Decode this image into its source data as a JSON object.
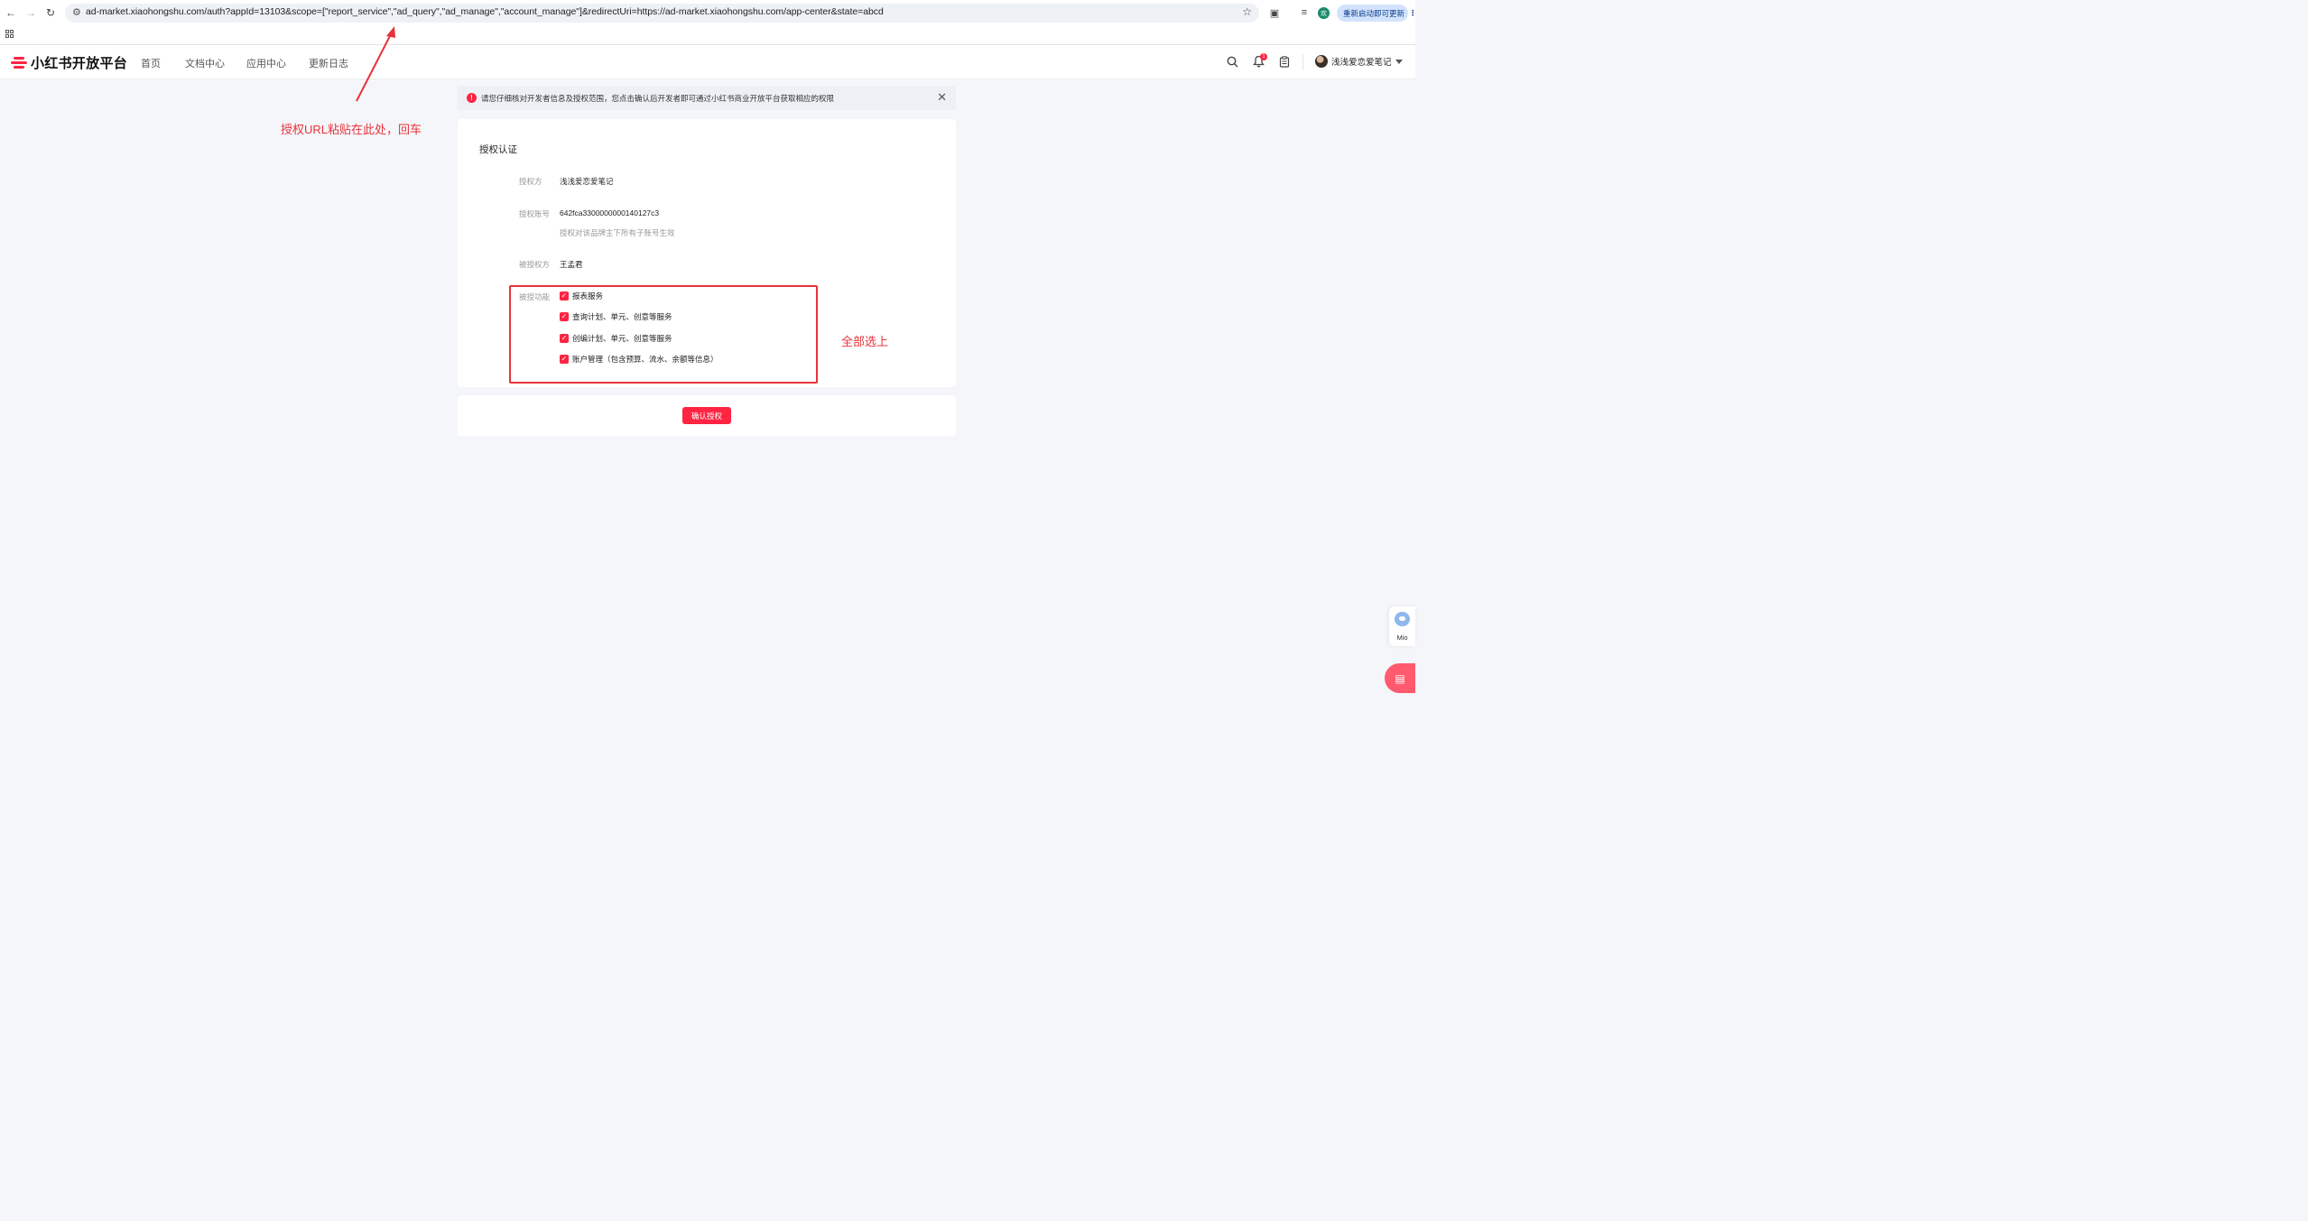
{
  "browser": {
    "url": "ad-market.xiaohongshu.com/auth?appId=13103&scope=[\"report_service\",\"ad_query\",\"ad_manage\",\"account_manage\"]&redirectUri=https://ad-market.xiaohongshu.com/app-center&state=abcd",
    "profile_initial": "欢",
    "update_label": "重新启动即可更新"
  },
  "header": {
    "logo_text": "小红书开放平台",
    "nav": [
      "首页",
      "文档中心",
      "应用中心",
      "更新日志"
    ],
    "notification_count": "1",
    "user_name": "浅浅爱恋爱笔记"
  },
  "banner": {
    "message": "请您仔细核对开发者信息及授权范围，您点击确认后开发者即可通过小红书商业开放平台获取相应的权限"
  },
  "auth": {
    "title": "授权认证",
    "grantor_label": "授权方",
    "grantor_value": "浅浅爱恋爱笔记",
    "account_label": "授权账号",
    "account_value": "642fca3300000000140127c3",
    "account_hint": "授权对该品牌主下所有子账号生效",
    "grantee_label": "被授权方",
    "grantee_value": "王孟君",
    "functions_label": "被授功能",
    "functions": [
      {
        "label": "报表服务",
        "checked": true
      },
      {
        "label": "查询计划、单元、创意等服务",
        "checked": true
      },
      {
        "label": "创编计划、单元、创意等服务",
        "checked": true
      },
      {
        "label": "账户管理（包含预算、流水、余额等信息）",
        "checked": true
      }
    ],
    "confirm_label": "确认授权"
  },
  "annotations": {
    "url_hint": "授权URL粘贴在此处，回车",
    "select_all_hint": "全部选上"
  },
  "floating": {
    "mio_label": "Mio"
  },
  "colors": {
    "brand": "#ff2442",
    "annotation": "#e8333a",
    "page_bg": "#f5f6fa"
  }
}
